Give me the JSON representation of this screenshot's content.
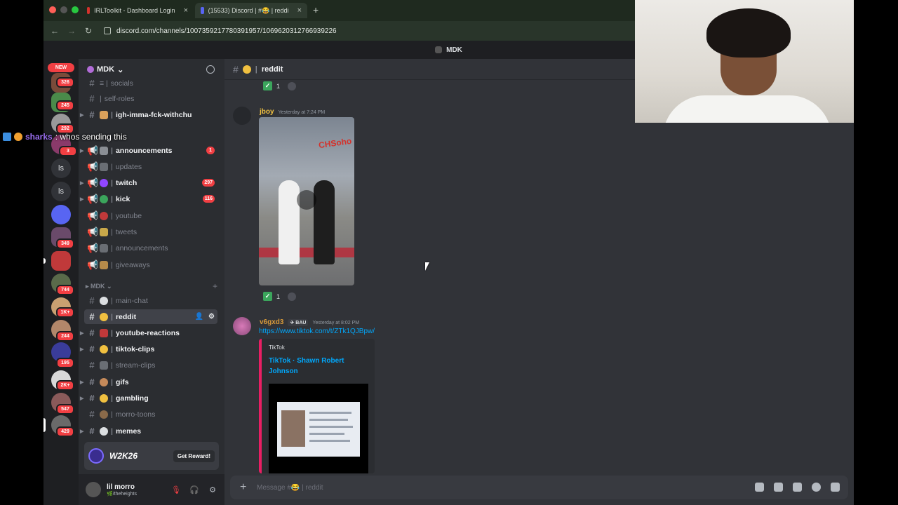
{
  "browser": {
    "tabs": [
      {
        "label": "IRLToolkit - Dashboard Login",
        "close": "×"
      },
      {
        "label": "(15533) Discord | #😂 | reddi",
        "close": "×"
      }
    ],
    "new_tab": "+",
    "url": "discord.com/channels/1007359217780391957/1069620312766939226"
  },
  "title_bar": {
    "server": "MDK"
  },
  "server_rail": {
    "new_badge": "NEW",
    "badges": [
      "326",
      "245",
      "292",
      "3",
      "349",
      "744",
      "1K+",
      "244",
      "195",
      "2K+",
      "547",
      "429"
    ],
    "ls1": "ls",
    "ls2": "ls"
  },
  "sidebar": {
    "server_name": "MDK",
    "server_chevron": "⌄",
    "channels": [
      {
        "name": "socials",
        "emoji_color": "#555"
      },
      {
        "name": "self-roles",
        "emoji_color": ""
      },
      {
        "name": "igh-imma-fck-withchu",
        "emoji_color": "#d9a05b"
      },
      {
        "name": "announcements",
        "count": "1"
      },
      {
        "name": "updates"
      },
      {
        "name": "twitch",
        "count": "297"
      },
      {
        "name": "kick",
        "count": "116"
      },
      {
        "name": "youtube"
      },
      {
        "name": "tweets"
      },
      {
        "name": "announcements"
      },
      {
        "name": "giveaways"
      }
    ],
    "category": "MDK",
    "category_channels": [
      {
        "name": "main-chat"
      },
      {
        "name": "reddit"
      },
      {
        "name": "youtube-reactions"
      },
      {
        "name": "tiktok-clips"
      },
      {
        "name": "stream-clips"
      },
      {
        "name": "gifs"
      },
      {
        "name": "gambling"
      },
      {
        "name": "morro-toons"
      },
      {
        "name": "memes"
      }
    ],
    "promo": {
      "logo": "W2K26",
      "cta": "Get Reward!"
    },
    "user": {
      "name": "lil morro",
      "status": "🌿/theheights"
    }
  },
  "main": {
    "channel": "reddit",
    "messages": [
      {
        "author": "jboy",
        "timestamp": "Yesterday at 7:24 PM",
        "video_sign": "CHSoho",
        "reaction_count": "1"
      },
      {
        "author": "v6gxd3",
        "tag": "BAU",
        "timestamp": "Yesterday at 8:02 PM",
        "link": "https://www.tiktok.com/t/ZTk1QJBpw/",
        "embed_provider": "TikTok",
        "embed_title": "TikTok · Shawn Robert Johnson"
      }
    ],
    "top_reaction_count": "1",
    "composer_placeholder": "Message #😂 | reddit"
  },
  "overlay": {
    "chat_user": "sharks",
    "chat_message": ": whos sending this"
  },
  "colors": {
    "accent": "#5865f2",
    "danger": "#f23f43",
    "link": "#00a8fc",
    "embed_border": "#e91e63"
  }
}
